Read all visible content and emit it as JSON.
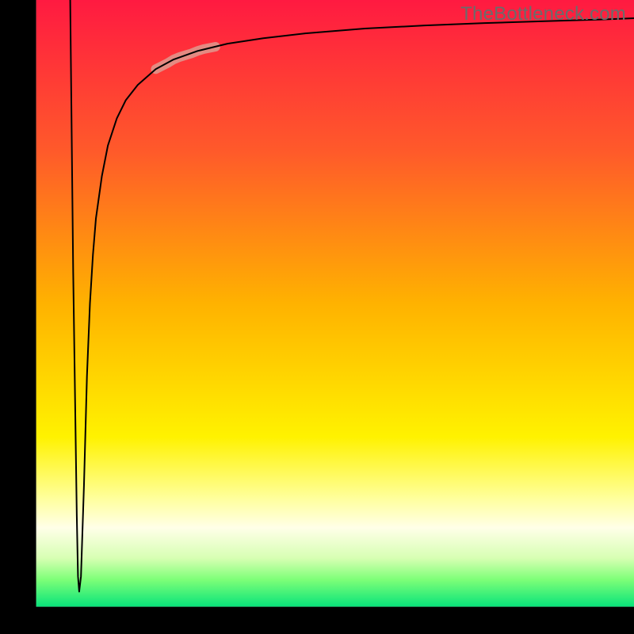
{
  "watermark": "TheBottleneck.com",
  "chart_data": {
    "type": "line",
    "title": "",
    "xlabel": "",
    "ylabel": "",
    "xlim": [
      0,
      100
    ],
    "ylim": [
      0,
      100
    ],
    "grid": false,
    "legend": false,
    "background_gradient_stops": [
      {
        "pos": 0.0,
        "color": "#ff1a41"
      },
      {
        "pos": 0.25,
        "color": "#ff5a2a"
      },
      {
        "pos": 0.5,
        "color": "#ffb200"
      },
      {
        "pos": 0.72,
        "color": "#fff200"
      },
      {
        "pos": 0.82,
        "color": "#ffff9a"
      },
      {
        "pos": 0.87,
        "color": "#ffffe8"
      },
      {
        "pos": 0.92,
        "color": "#d7ffb3"
      },
      {
        "pos": 0.955,
        "color": "#7eff78"
      },
      {
        "pos": 1.0,
        "color": "#08e37a"
      }
    ],
    "axis_bands": {
      "left_width_frac": 0.057,
      "bottom_height_frac": 0.043
    },
    "series": [
      {
        "name": "bottleneck-curve",
        "stroke": "#000000",
        "stroke_width": 2,
        "x": [
          5.7,
          6.2,
          6.8,
          7.0,
          7.2,
          7.5,
          8.0,
          8.5,
          9.0,
          9.5,
          10.0,
          11.0,
          12.0,
          13.5,
          15.0,
          17.0,
          20.0,
          23.0,
          27.0,
          32.0,
          38.0,
          45.0,
          55.0,
          65.0,
          75.0,
          85.0,
          95.0,
          100.0
        ],
        "y": [
          100.0,
          55.0,
          15.0,
          5.0,
          2.5,
          5.0,
          20.0,
          38.0,
          50.0,
          58.0,
          64.0,
          71.0,
          76.0,
          80.5,
          83.5,
          86.0,
          88.6,
          90.2,
          91.6,
          92.8,
          93.7,
          94.5,
          95.3,
          95.8,
          96.2,
          96.5,
          96.8,
          97.0
        ]
      }
    ],
    "highlight": {
      "name": "salmon-segment",
      "stroke": "#df9a8f",
      "stroke_width": 12,
      "opacity": 0.85,
      "x": [
        20.0,
        21.0,
        22.0,
        23.0,
        24.0,
        25.0,
        26.0,
        27.0,
        28.0,
        29.0,
        30.0
      ],
      "y": [
        88.6,
        89.1,
        89.6,
        90.2,
        90.6,
        90.9,
        91.2,
        91.6,
        91.9,
        92.1,
        92.3
      ]
    }
  }
}
